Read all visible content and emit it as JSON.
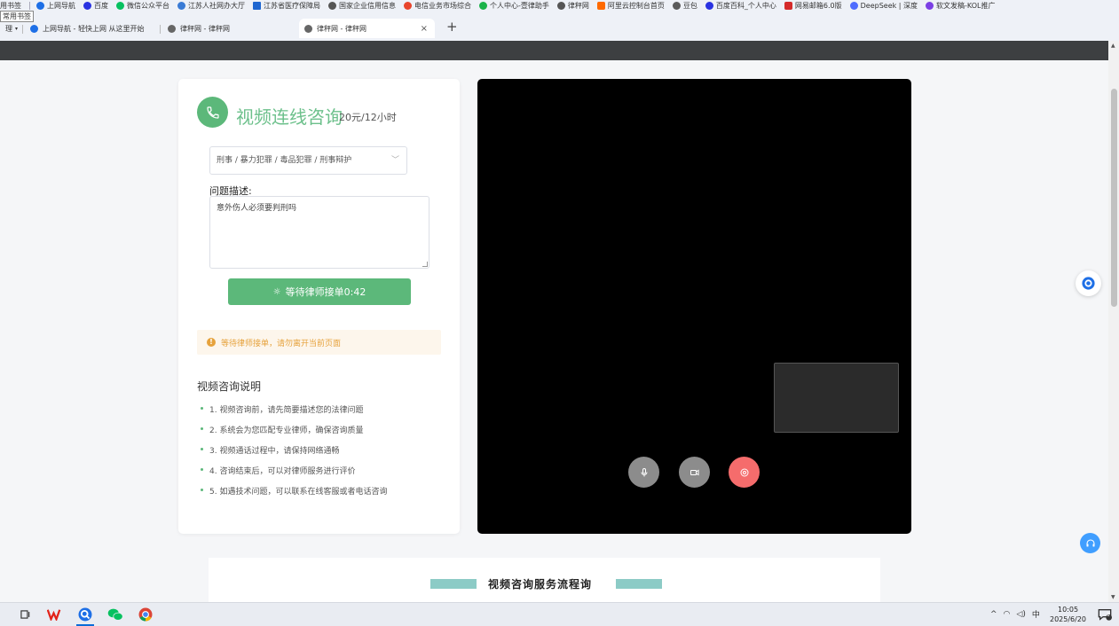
{
  "browser": {
    "bookmark_tooltip": "常用书签",
    "bookmarks": [
      {
        "label": "用书签",
        "icon": "folder-icon",
        "color": "#d9a400"
      },
      {
        "label": "上网导航",
        "icon": "search-icon",
        "color": "#1e6fe6"
      },
      {
        "label": "百度",
        "icon": "baidu-icon",
        "color": "#2932e1"
      },
      {
        "label": "微信公众平台",
        "icon": "wechat-icon",
        "color": "#07c160"
      },
      {
        "label": "江苏人社网办大厅",
        "icon": "globe-icon",
        "color": "#3a7bd5"
      },
      {
        "label": "江苏省医疗保障局",
        "icon": "globe-icon",
        "color": "#1e66d0"
      },
      {
        "label": "国家企业信用信息",
        "icon": "globe-icon",
        "color": "#555555"
      },
      {
        "label": "电信业务市场综合",
        "icon": "globe-icon",
        "color": "#e8452c"
      },
      {
        "label": "个人中心-壹律助手",
        "icon": "globe-icon",
        "color": "#1bb34a"
      },
      {
        "label": "律秤网",
        "icon": "globe-icon",
        "color": "#555555"
      },
      {
        "label": "阿里云控制台首页",
        "icon": "aliyun-icon",
        "color": "#ff6a00"
      },
      {
        "label": "豆包",
        "icon": "doubao-icon",
        "color": "#5a5a5a"
      },
      {
        "label": "百度百科_个人中心",
        "icon": "baidu-icon",
        "color": "#2932e1"
      },
      {
        "label": "网易邮箱6.0版",
        "icon": "mail-icon",
        "color": "#d42a2a"
      },
      {
        "label": "DeepSeek | 深度",
        "icon": "deepseek-icon",
        "color": "#4d6bfe"
      },
      {
        "label": "软文发稿-KOL推广",
        "icon": "globe-icon",
        "color": "#7b3fe4"
      }
    ],
    "tabs": [
      {
        "label": "理",
        "icon": "chevron-down-icon"
      },
      {
        "label": "上网导航 - 轻快上网 从这里开始",
        "icon": "search-icon"
      },
      {
        "label": "律秤网 - 律秤网",
        "icon": "globe-icon"
      },
      {
        "label": "律秤网 - 律秤网",
        "icon": "globe-icon",
        "active": true
      }
    ],
    "new_tab": "+",
    "close": "×"
  },
  "consult": {
    "title": "视频连线咨询",
    "price": "20元/12小时",
    "category": "刑事 / 暴力犯罪 / 毒品犯罪 / 刑事辩护",
    "question_label": "问题描述:",
    "question_value": "意外伤人必须要判刑吗",
    "wait_button": "等待律师接单0:42",
    "notice": "等待律师接单，请勿离开当前页面",
    "info_title": "视频咨询说明",
    "info_items": [
      "1. 视频咨询前，请先简要描述您的法律问题",
      "2. 系统会为您匹配专业律师，确保咨询质量",
      "3. 视频通话过程中，请保持网络通畅",
      "4. 咨询结束后，可以对律师服务进行评价",
      "5. 如遇技术问题，可以联系在线客服或者电话咨询"
    ]
  },
  "process": {
    "title": "视频咨询服务流程询"
  },
  "taskbar": {
    "tray_ime": "中",
    "time": "10:05",
    "date": "2025/6/20",
    "notif_count": "1"
  },
  "colors": {
    "accent": "#5cb87a",
    "danger": "#f56c6c",
    "warning": "#e6a23c",
    "header": "#3d3f41"
  }
}
